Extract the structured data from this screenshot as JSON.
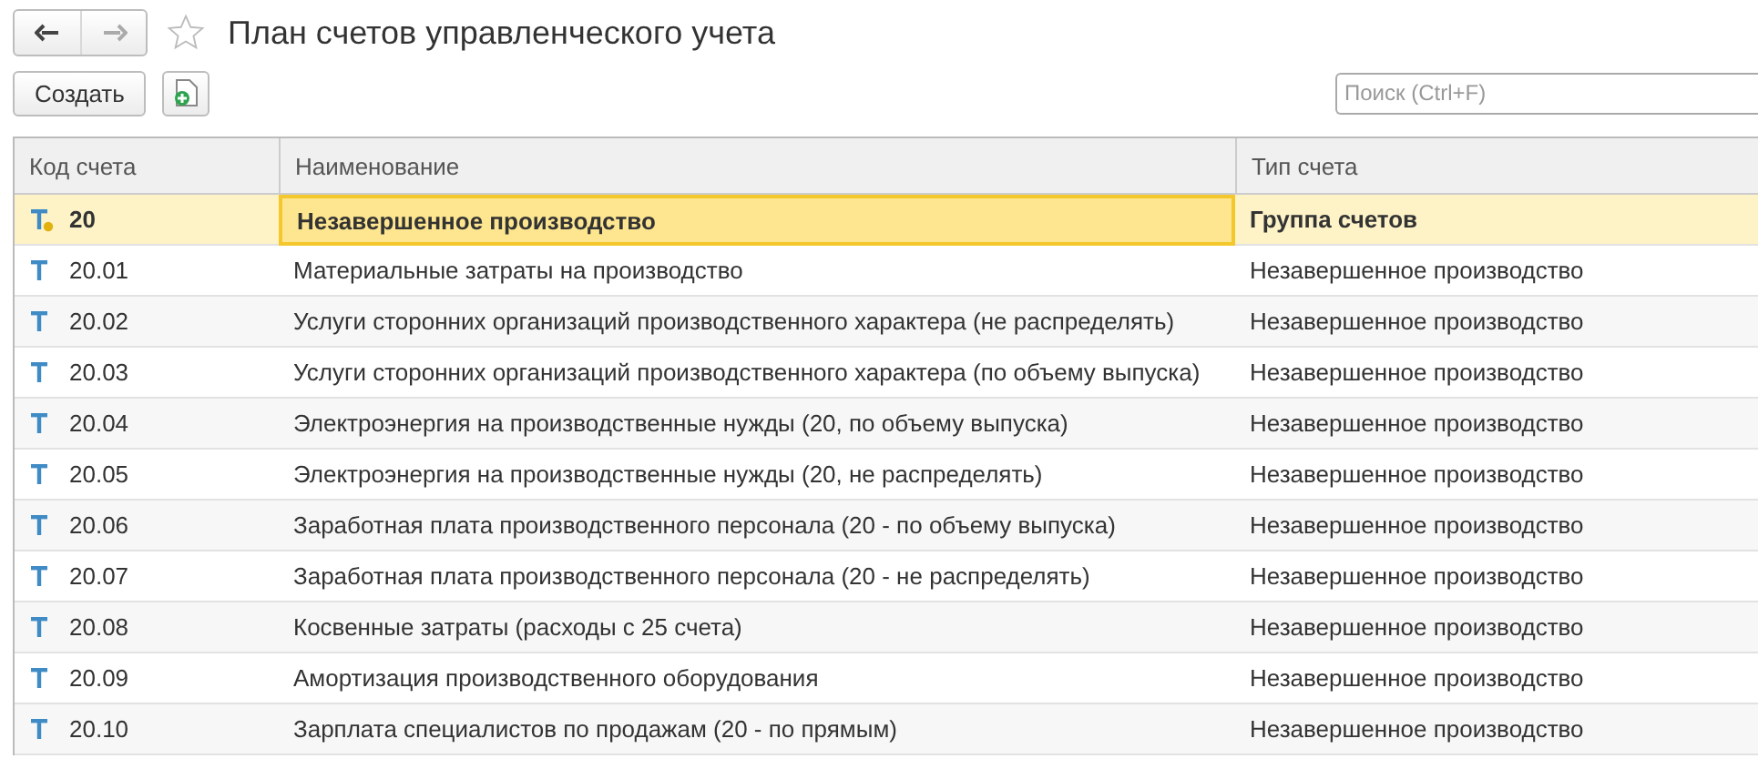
{
  "window": {
    "title": "План счетов управленческого учета",
    "favorite": false
  },
  "toolbar": {
    "create_button": "Создать",
    "search": {
      "placeholder": "Поиск (Ctrl+F)"
    }
  },
  "table": {
    "columns": [
      "Код счета",
      "Наименование",
      "Тип счета"
    ],
    "rows": [
      {
        "kind": "group",
        "selected": true,
        "code": "20",
        "name": "Незавершенное производство",
        "type": "Группа счетов"
      },
      {
        "kind": "account",
        "selected": false,
        "code": "20.01",
        "name": "Материальные затраты на производство",
        "type": "Незавершенное производство"
      },
      {
        "kind": "account",
        "selected": false,
        "code": "20.02",
        "name": "Услуги сторонних организаций производственного характера (не распределять)",
        "type": "Незавершенное производство"
      },
      {
        "kind": "account",
        "selected": false,
        "code": "20.03",
        "name": "Услуги сторонних организаций производственного характера (по объему выпуска)",
        "type": "Незавершенное производство"
      },
      {
        "kind": "account",
        "selected": false,
        "code": "20.04",
        "name": "Электроэнергия на производственные нужды (20, по объему выпуска)",
        "type": "Незавершенное производство"
      },
      {
        "kind": "account",
        "selected": false,
        "code": "20.05",
        "name": "Электроэнергия на производственные нужды (20, не распределять)",
        "type": "Незавершенное производство"
      },
      {
        "kind": "account",
        "selected": false,
        "code": "20.06",
        "name": "Заработная плата производственного персонала (20 - по объему выпуска)",
        "type": "Незавершенное производство"
      },
      {
        "kind": "account",
        "selected": false,
        "code": "20.07",
        "name": "Заработная плата производственного персонала (20 - не распределять)",
        "type": "Незавершенное производство"
      },
      {
        "kind": "account",
        "selected": false,
        "code": "20.08",
        "name": "Косвенные затраты (расходы с 25 счета)",
        "type": "Незавершенное производство"
      },
      {
        "kind": "account",
        "selected": false,
        "code": "20.09",
        "name": "Амортизация производственного оборудования",
        "type": "Незавершенное производство"
      },
      {
        "kind": "account",
        "selected": false,
        "code": "20.10",
        "name": "Зарплата специалистов по продажам (20 - по прямым)",
        "type": "Незавершенное производство"
      }
    ]
  }
}
